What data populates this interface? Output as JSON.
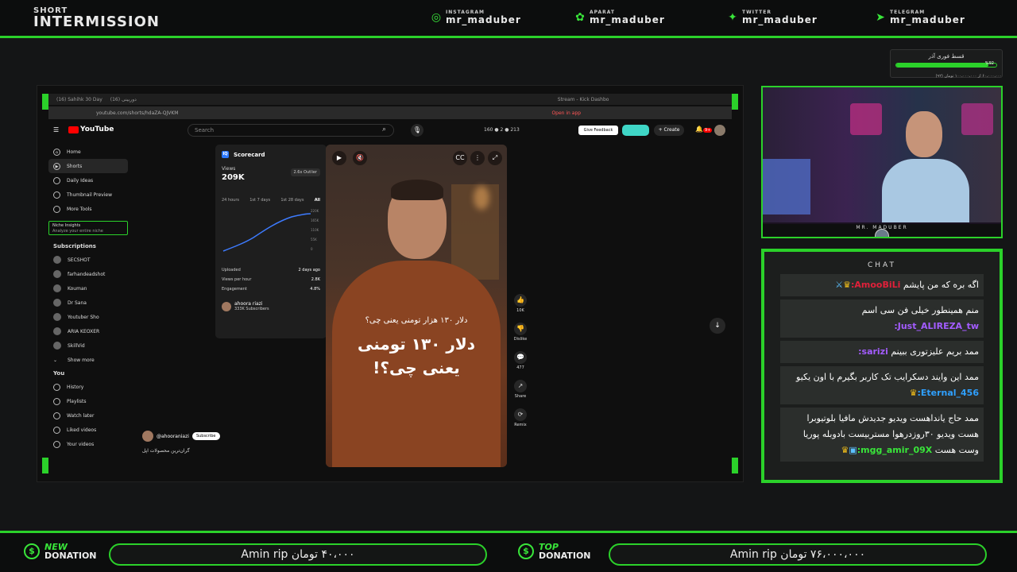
{
  "brand": {
    "line1": "SHORT",
    "line2": "INTERMISSION"
  },
  "socials": [
    {
      "platform": "INSTAGRAM",
      "handle": "mr_maduber",
      "icon": "instagram-icon"
    },
    {
      "platform": "APARAT",
      "handle": "mr_maduber",
      "icon": "aparat-icon"
    },
    {
      "platform": "TWITTER",
      "handle": "mr_maduber",
      "icon": "twitter-icon"
    },
    {
      "platform": "TELEGRAM",
      "handle": "mr_maduber",
      "icon": "telegram-icon"
    }
  ],
  "goal": {
    "title": "قسط فوری آذر",
    "percent": "%92",
    "progress": 0.92,
    "subtitle": "۶۰،۰۰۰،۰۰۰ از ۱۰۰،۰۰۰،۰۰۰ تومان (۹۲)"
  },
  "browser": {
    "tabs": [
      "(16) Sahihk 30 Day",
      "دوربینی (16)",
      "Stream - Kick Dashbo"
    ],
    "url": "youtube.com/shorts/hdaZA-QJVKM",
    "open_in_app": "Open in app"
  },
  "youtube": {
    "logo": "YouTube",
    "search_placeholder": "Search",
    "stats": "160 ● 2 ● 213",
    "feedback": "Give Feedback",
    "create": "+ Create",
    "notif_count": "9+",
    "nav": [
      {
        "label": "Home",
        "icon": "home-icon"
      },
      {
        "label": "Shorts",
        "icon": "shorts-icon",
        "active": true
      },
      {
        "label": "Daily Ideas",
        "icon": "ideas-icon"
      },
      {
        "label": "Thumbnail Preview",
        "icon": "thumbnail-icon"
      },
      {
        "label": "More Tools",
        "icon": "tools-icon"
      }
    ],
    "niche": {
      "title": "Niche Insights",
      "subtitle": "Analyze your entire niche"
    },
    "subscriptions_header": "Subscriptions",
    "subscriptions": [
      "SECSHOT",
      "farhandeadshot",
      "Kouman",
      "Dr Sana",
      "Youtuber Sho",
      "ARIA KEOXER",
      "SkillVid",
      "Show more"
    ],
    "you_header": "You",
    "you_items": [
      "History",
      "Playlists",
      "Watch later",
      "Liked videos",
      "Your videos"
    ],
    "scorecard": {
      "title": "Scorecard",
      "views_label": "Views",
      "views": "209K",
      "outlier": "2.6x Outlier",
      "ranges": [
        "24 hours",
        "1st 7 days",
        "1st 28 days",
        "All"
      ],
      "y_ticks": [
        "220K",
        "165K",
        "110K",
        "55K",
        "0"
      ],
      "rows": [
        {
          "label": "Uploaded",
          "value": "2 days ago"
        },
        {
          "label": "Views per hour",
          "value": "2.8K"
        },
        {
          "label": "Engagement",
          "value": "4.8%"
        }
      ],
      "channel": "ahoora riazi",
      "channel_subs": "333K Subscribers"
    },
    "video": {
      "caption_small": "دلار ۱۳۰ هزار تومنی یعنی چی؟",
      "caption_big_1": "دلار ۱۳۰ تومنی",
      "caption_big_2": "یعنی چی؟!"
    },
    "actions": [
      {
        "icon": "like-icon",
        "label": "10K"
      },
      {
        "icon": "dislike-icon",
        "label": "Dislike"
      },
      {
        "icon": "comment-icon",
        "label": "477"
      },
      {
        "icon": "share-icon",
        "label": "Share"
      },
      {
        "icon": "remix-icon",
        "label": "Remix"
      }
    ],
    "channel_handle": "@ahooraniazi",
    "subscribe": "Subscribe",
    "description": "گران‌ترین محصولات اپل"
  },
  "camera": {
    "name": "MR. MADUBER"
  },
  "chat": {
    "title": "CHAT",
    "messages": [
      {
        "user": "AmooBiLi:",
        "color": "#e0203a",
        "text": "اگه بره که من پایشم"
      },
      {
        "user": "Just_ALIREZA_tw:",
        "color": "#a35cff",
        "text": "منم همینطور خیلی فن سی اسم"
      },
      {
        "user": "sarizi:",
        "color": "#a35cff",
        "text": "ممد بریم علیزتوری ببینم"
      },
      {
        "user": "Eternal_456:",
        "color": "#2fa0ff",
        "text": "ممد این وایند دسکرایب تک کاربر بگیرم با اون یکیو"
      },
      {
        "user": "mgg_amir_09X:",
        "color": "#39e53a",
        "text": "ممد حاج یانداهست ویدیو جدیدش مافیا بلوتیوبرا هست ویدیو ۳۰روزدرهوا مستربیست بادوبله پوریا وست هست"
      }
    ]
  },
  "donations": {
    "new": {
      "k1": "NEW",
      "k2": "DONATION",
      "text": "۴۰،۰۰۰ تومان Amin rip"
    },
    "top": {
      "k1": "TOP",
      "k2": "DONATION",
      "text": "۷۶،۰۰۰،۰۰۰ تومان Amin rip"
    }
  }
}
